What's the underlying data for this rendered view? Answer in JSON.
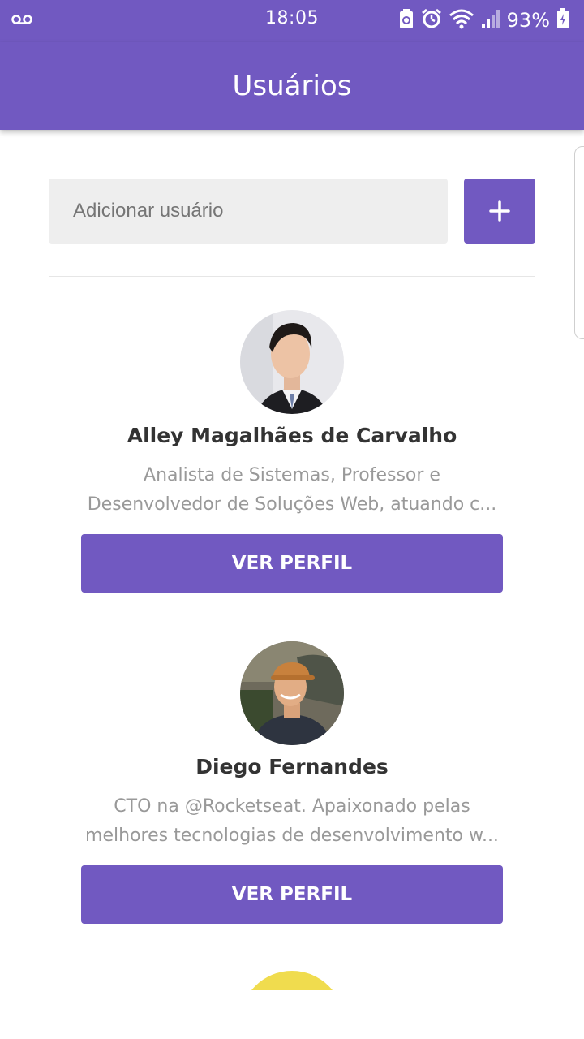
{
  "status_bar": {
    "time": "18:05",
    "battery_percent": "93%",
    "icons": [
      "voicemail-icon",
      "battery-saver-icon",
      "alarm-icon",
      "wifi-icon",
      "signal-icon",
      "battery-icon"
    ]
  },
  "app_bar": {
    "title": "Usuários"
  },
  "add_user": {
    "placeholder": "Adicionar usuário",
    "button_icon": "plus-icon"
  },
  "users": [
    {
      "name": "Alley Magalhães de Carvalho",
      "bio_line1": "Analista de Sistemas, Professor e",
      "bio_line2": "Desenvolvedor de Soluções Web, atuando c...",
      "button_label": "VER PERFIL"
    },
    {
      "name": "Diego Fernandes",
      "bio_line1": "CTO na @Rocketseat. Apaixonado pelas",
      "bio_line2": "melhores tecnologias de desenvolvimento w...",
      "button_label": "VER PERFIL"
    }
  ],
  "colors": {
    "primary": "#7159c1",
    "input_bg": "#eeeeee",
    "placeholder": "#999999",
    "name_text": "#333333",
    "third_avatar": "#f0dc4e"
  }
}
